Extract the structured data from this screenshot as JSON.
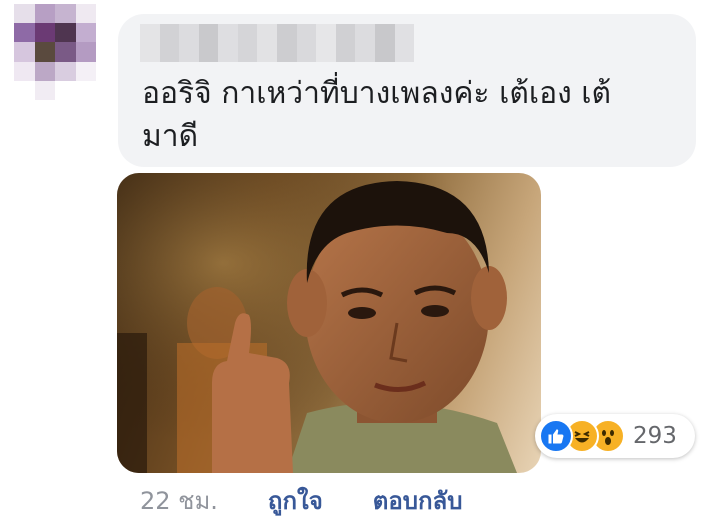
{
  "comment": {
    "text_line1": "ออริจิ กาเหว่าที่บางเพลงค่ะ เต้เอง เต้",
    "text_line2": "มาดี"
  },
  "reactions": {
    "icons": [
      "like-icon",
      "haha-icon",
      "wow-icon"
    ],
    "count": "293"
  },
  "footer": {
    "timestamp": "22 ชม.",
    "like_label": "ถูกใจ",
    "reply_label": "ตอบกลับ"
  },
  "colors": {
    "bubble_background": "#f2f3f5",
    "link": "#385898",
    "like_blue": "#1877f2",
    "reaction_yellow": "#f7b125",
    "meta_gray": "#90949c"
  }
}
